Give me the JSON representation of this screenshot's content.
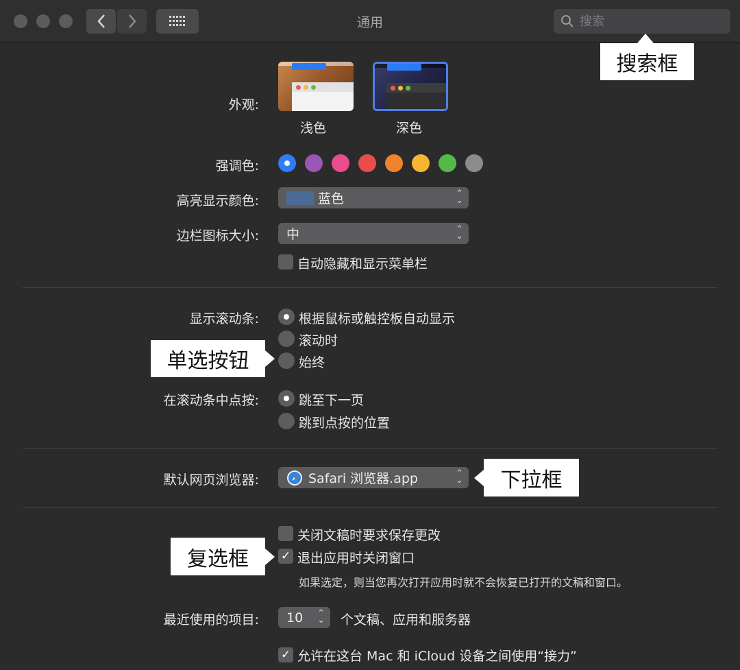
{
  "window": {
    "title": "通用"
  },
  "search": {
    "placeholder": "搜索"
  },
  "appearance": {
    "label": "外观:",
    "light": "浅色",
    "dark": "深色"
  },
  "accent": {
    "label": "强调色:",
    "colors": [
      "#2f7cf6",
      "#9b55b5",
      "#e94d8c",
      "#ea4c4c",
      "#f0832f",
      "#f6b633",
      "#55b94a",
      "#8c8c8c"
    ],
    "selected_index": 0
  },
  "highlight": {
    "label": "高亮显示颜色:",
    "value": "蓝色",
    "swatch": "#4c6a96"
  },
  "sidebar_icon": {
    "label": "边栏图标大小:",
    "value": "中"
  },
  "menubar": {
    "label": "自动隐藏和显示菜单栏",
    "checked": false
  },
  "scrollbars": {
    "label": "显示滚动条:",
    "options": [
      "根据鼠标或触控板自动显示",
      "滚动时",
      "始终"
    ],
    "selected_index": 0
  },
  "click_scroll": {
    "label": "在滚动条中点按:",
    "options": [
      "跳至下一页",
      "跳到点按的位置"
    ],
    "selected_index": 0
  },
  "browser": {
    "label": "默认网页浏览器:",
    "value": "Safari 浏览器.app"
  },
  "close_docs": {
    "label": "关闭文稿时要求保存更改",
    "checked": false
  },
  "quit_apps": {
    "label": "退出应用时关闭窗口",
    "checked": true,
    "hint": "如果选定，则当您再次打开应用时就不会恢复已打开的文稿和窗口。"
  },
  "recent": {
    "label": "最近使用的项目:",
    "value": "10",
    "suffix": "个文稿、应用和服务器"
  },
  "handoff": {
    "label": "允许在这台 Mac 和 iCloud 设备之间使用“接力”",
    "checked": true
  },
  "callouts": {
    "search": "搜索框",
    "radio": "单选按钮",
    "dropdown": "下拉框",
    "checkbox": "复选框"
  }
}
